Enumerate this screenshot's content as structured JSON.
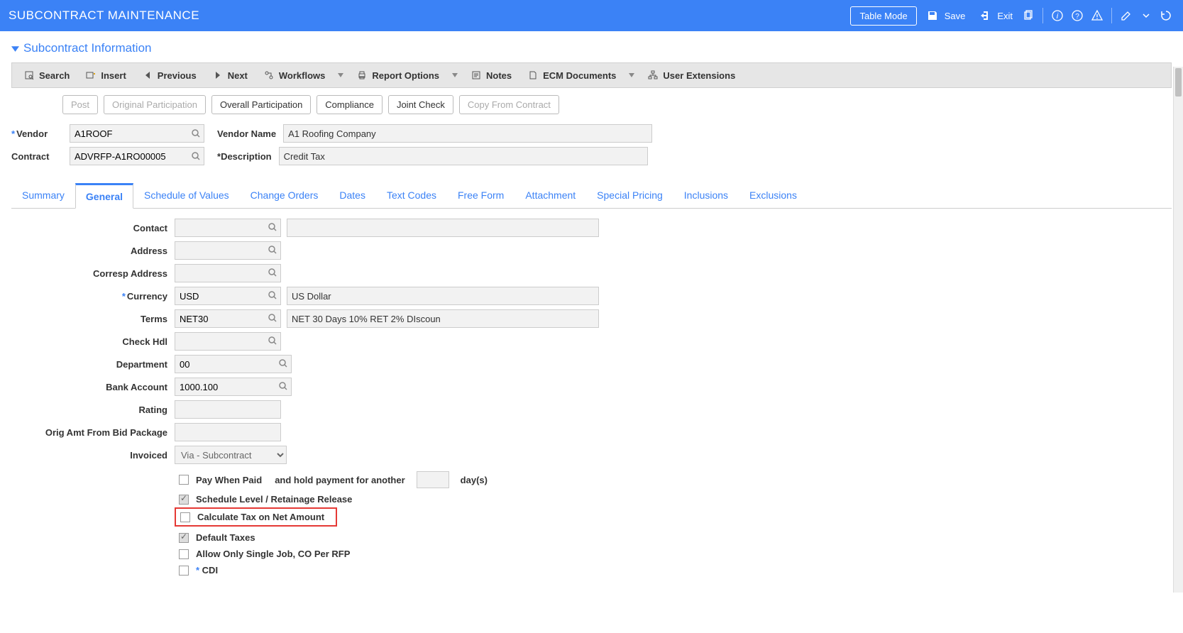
{
  "titlebar": {
    "title": "SUBCONTRACT MAINTENANCE",
    "table_mode": "Table Mode",
    "save": "Save",
    "exit": "Exit"
  },
  "section": {
    "title": "Subcontract Information"
  },
  "toolbar": {
    "search": "Search",
    "insert": "Insert",
    "previous": "Previous",
    "next": "Next",
    "workflows": "Workflows",
    "report_options": "Report Options",
    "notes": "Notes",
    "ecm_documents": "ECM Documents",
    "user_extensions": "User Extensions"
  },
  "actions": {
    "post": "Post",
    "original_participation": "Original Participation",
    "overall_participation": "Overall Participation",
    "compliance": "Compliance",
    "joint_check": "Joint Check",
    "copy_from_contract": "Copy From Contract"
  },
  "form": {
    "vendor_label": "Vendor",
    "vendor_value": "A1ROOF",
    "vendor_name_label": "Vendor Name",
    "vendor_name_value": "A1 Roofing Company",
    "contract_label": "Contract",
    "contract_value": "ADVRFP-A1RO00005",
    "description_label": "Description",
    "description_value": "Credit Tax"
  },
  "tabs": {
    "summary": "Summary",
    "general": "General",
    "schedule": "Schedule of Values",
    "change_orders": "Change Orders",
    "dates": "Dates",
    "text_codes": "Text Codes",
    "free_form": "Free Form",
    "attachment": "Attachment",
    "special_pricing": "Special Pricing",
    "inclusions": "Inclusions",
    "exclusions": "Exclusions"
  },
  "general": {
    "contact_label": "Contact",
    "contact_value": "",
    "contact_desc": "",
    "address_label": "Address",
    "address_value": "",
    "corresp_address_label": "Corresp Address",
    "corresp_address_value": "",
    "currency_label": "Currency",
    "currency_value": "USD",
    "currency_desc": "US Dollar",
    "terms_label": "Terms",
    "terms_value": "NET30",
    "terms_desc": "NET 30 Days 10% RET 2% DIscoun",
    "check_hdl_label": "Check Hdl",
    "check_hdl_value": "",
    "department_label": "Department",
    "department_value": "00",
    "bank_account_label": "Bank Account",
    "bank_account_value": "1000.100",
    "rating_label": "Rating",
    "rating_value": "",
    "orig_amt_label": "Orig Amt From Bid Package",
    "orig_amt_value": "",
    "invoiced_label": "Invoiced",
    "invoiced_value": "Via - Subcontract",
    "pay_when_paid": "Pay When Paid",
    "hold_text_a": "and hold payment for another",
    "hold_days_value": "",
    "hold_text_b": "day(s)",
    "schedule_level": "Schedule Level / Retainage Release",
    "calc_tax_net": "Calculate Tax on Net Amount",
    "default_taxes": "Default Taxes",
    "allow_single": "Allow Only Single Job, CO Per RFP",
    "cdi": "CDI"
  }
}
